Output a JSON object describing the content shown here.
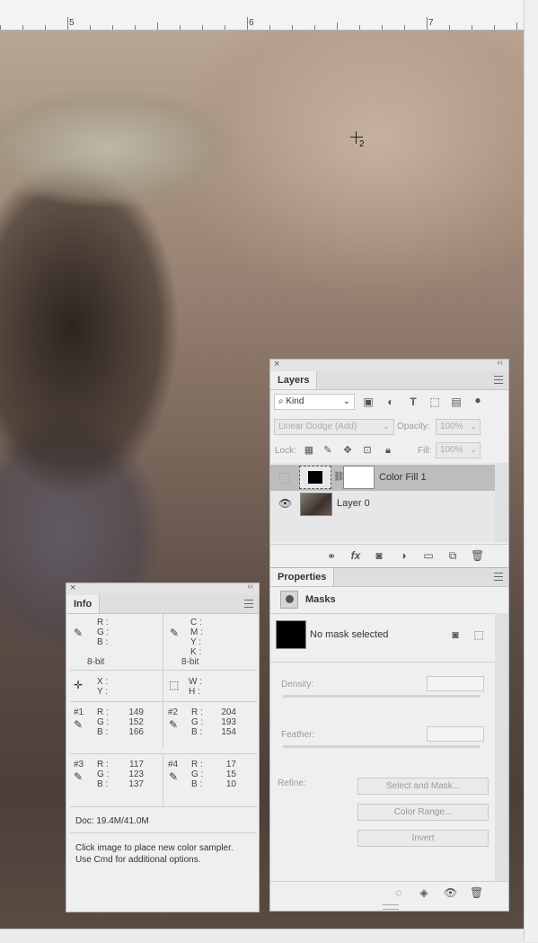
{
  "ruler": {
    "marks": [
      "5",
      "6",
      "7"
    ]
  },
  "canvas": {
    "sampler_label": "2"
  },
  "layers_panel": {
    "tab": "Layers",
    "filter_kind": "Kind",
    "blend_mode": "Linear Dodge (Add)",
    "opacity_label": "Opacity:",
    "opacity_value": "100%",
    "lock_label": "Lock:",
    "fill_label": "Fill:",
    "fill_value": "100%",
    "layers": [
      {
        "name": "Color Fill 1",
        "visible": false,
        "selected": true
      },
      {
        "name": "Layer 0",
        "visible": true,
        "selected": false
      }
    ],
    "footer_icons": [
      "link-icon",
      "fx-icon",
      "mask-icon",
      "adjustment-icon",
      "folder-icon",
      "new-layer-icon",
      "trash-icon"
    ]
  },
  "properties_panel": {
    "tab": "Properties",
    "section": "Masks",
    "mask_status": "No mask selected",
    "density_label": "Density:",
    "feather_label": "Feather:",
    "refine_label": "Refine:",
    "buttons": [
      "Select and Mask...",
      "Color Range...",
      "Invert"
    ]
  },
  "info_panel": {
    "tab": "Info",
    "rgb_block": {
      "labels": [
        "R :",
        "G :",
        "B :"
      ],
      "depth": "8-bit"
    },
    "cmyk_block": {
      "labels": [
        "C :",
        "M :",
        "Y :",
        "K :"
      ],
      "depth": "8-bit"
    },
    "xy_block": {
      "labels": [
        "X :",
        "Y :"
      ]
    },
    "wh_block": {
      "labels": [
        "W :",
        "H :"
      ]
    },
    "samplers": [
      {
        "id": "#1",
        "R": "149",
        "G": "152",
        "B": "166"
      },
      {
        "id": "#2",
        "R": "204",
        "G": "193",
        "B": "154"
      },
      {
        "id": "#3",
        "R": "117",
        "G": "123",
        "B": "137"
      },
      {
        "id": "#4",
        "R": "17",
        "G": "15",
        "B": "10"
      }
    ],
    "doc": "Doc: 19.4M/41.0M",
    "hint_line1": "Click image to place new color sampler.",
    "hint_line2": "Use Cmd for additional options."
  }
}
